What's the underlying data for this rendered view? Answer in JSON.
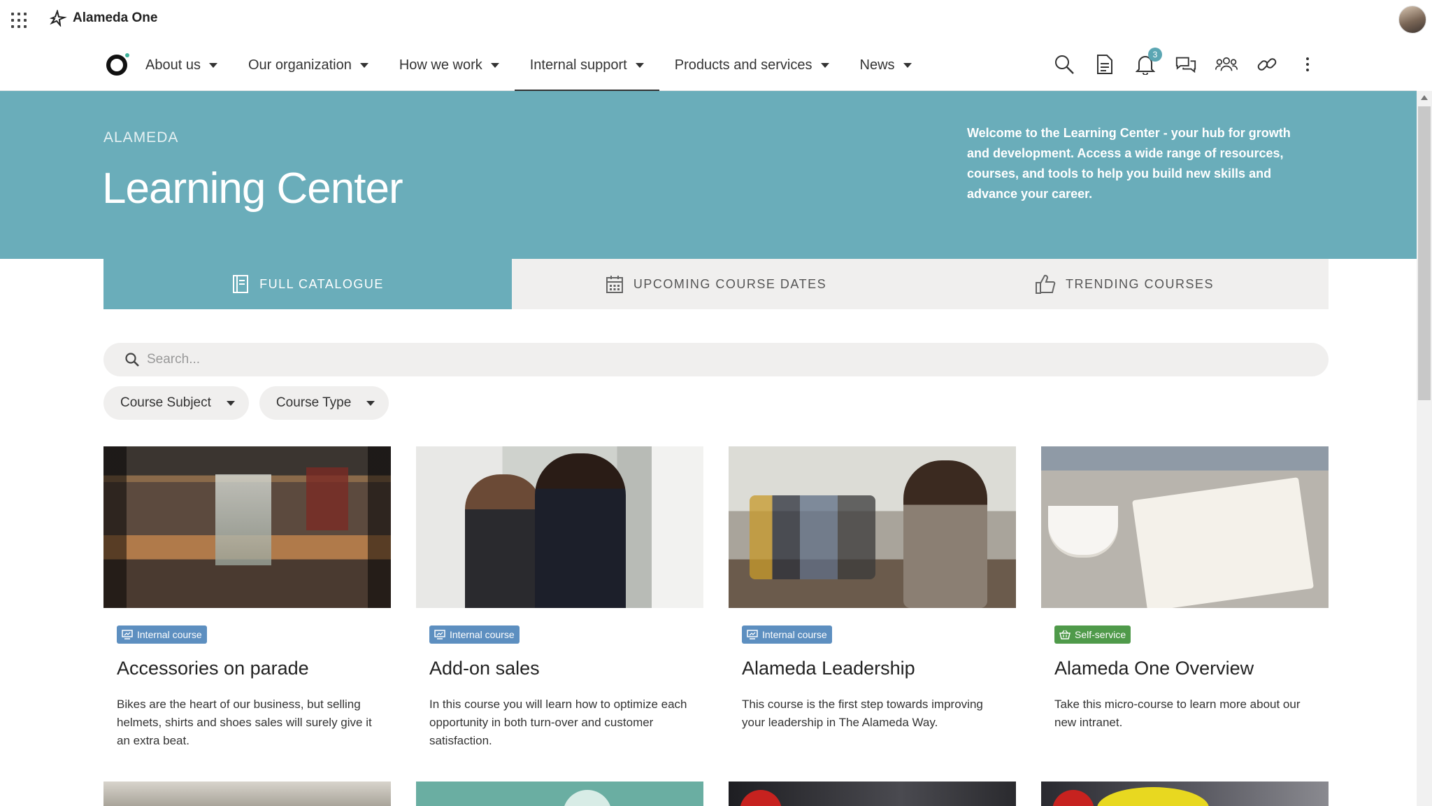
{
  "app": {
    "name": "Alameda One"
  },
  "nav": {
    "items": [
      {
        "label": "About us"
      },
      {
        "label": "Our organization"
      },
      {
        "label": "How we work"
      },
      {
        "label": "Internal support"
      },
      {
        "label": "Products and services"
      },
      {
        "label": "News"
      }
    ],
    "active_index": 3,
    "notification_count": "3"
  },
  "hero": {
    "eyebrow": "ALAMEDA",
    "title": "Learning Center",
    "text": "Welcome to the Learning Center - your hub for growth and development. Access a wide range of resources, courses, and tools to help you build new skills and advance your career.",
    "color": "#6aadba"
  },
  "tabs": [
    {
      "label": "FULL CATALOGUE",
      "icon": "catalogue-icon"
    },
    {
      "label": "UPCOMING COURSE DATES",
      "icon": "calendar-icon"
    },
    {
      "label": "TRENDING COURSES",
      "icon": "thumbs-up-icon"
    }
  ],
  "search": {
    "placeholder": "Search..."
  },
  "filters": [
    {
      "label": "Course Subject"
    },
    {
      "label": "Course Type"
    }
  ],
  "cards": [
    {
      "tag": "Internal course",
      "tag_color": "#5d8fc0",
      "title": "Accessories on parade",
      "desc": "Bikes are the heart of our business, but selling helmets, shirts and shoes sales will surely give it an extra beat."
    },
    {
      "tag": "Internal course",
      "tag_color": "#5d8fc0",
      "title": "Add-on sales",
      "desc": "In this course you will learn how to optimize each opportunity in both turn-over and customer satisfaction."
    },
    {
      "tag": "Internal course",
      "tag_color": "#5d8fc0",
      "title": "Alameda Leadership",
      "desc": "This course is the first step towards improving your leadership in The Alameda Way."
    },
    {
      "tag": "Self-service",
      "tag_color": "#4f9a4a",
      "title": "Alameda One Overview",
      "desc": "Take this micro-course to learn more about our new intranet."
    }
  ]
}
